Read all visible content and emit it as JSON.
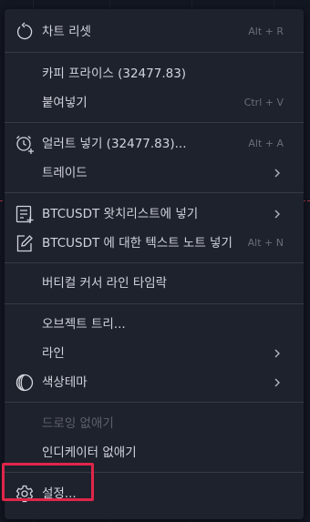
{
  "colors": {
    "menu_bg": "#1e222d",
    "text": "#d1d4dc",
    "shortcut": "#6a6d78",
    "disabled": "#5d606b",
    "separator": "#363a45",
    "highlight": "#e0264a",
    "chart_bg": "#131722"
  },
  "menu": {
    "reset_chart": {
      "label": "차트 리셋",
      "shortcut": "Alt + R",
      "icon": "reset-icon"
    },
    "copy_price": {
      "label": "카피 프라이스 (32477.83)"
    },
    "paste": {
      "label": "붙여넣기",
      "shortcut": "Ctrl + V"
    },
    "add_alert": {
      "label": "얼러트 넣기 (32477.83)...",
      "shortcut": "Alt + A",
      "icon": "alarm-add-icon"
    },
    "trade": {
      "label": "트레이드"
    },
    "add_watchlist": {
      "label": "BTCUSDT 왓치리스트에 넣기",
      "icon": "list-add-icon"
    },
    "add_note": {
      "label": "BTCUSDT 에 대한 텍스트 노트 넣기",
      "shortcut": "Alt + N",
      "icon": "pencil-note-icon"
    },
    "lock_vertical": {
      "label": "버티컬 커서 라인 타임락"
    },
    "object_tree": {
      "label": "오브젝트 트리..."
    },
    "lines": {
      "label": "라인"
    },
    "color_theme": {
      "label": "색상테마",
      "icon": "moon-icon"
    },
    "remove_drawings": {
      "label": "드로잉 없애기"
    },
    "remove_indicators": {
      "label": "인디케이터 없애기"
    },
    "settings": {
      "label": "설정...",
      "icon": "gear-icon"
    }
  }
}
